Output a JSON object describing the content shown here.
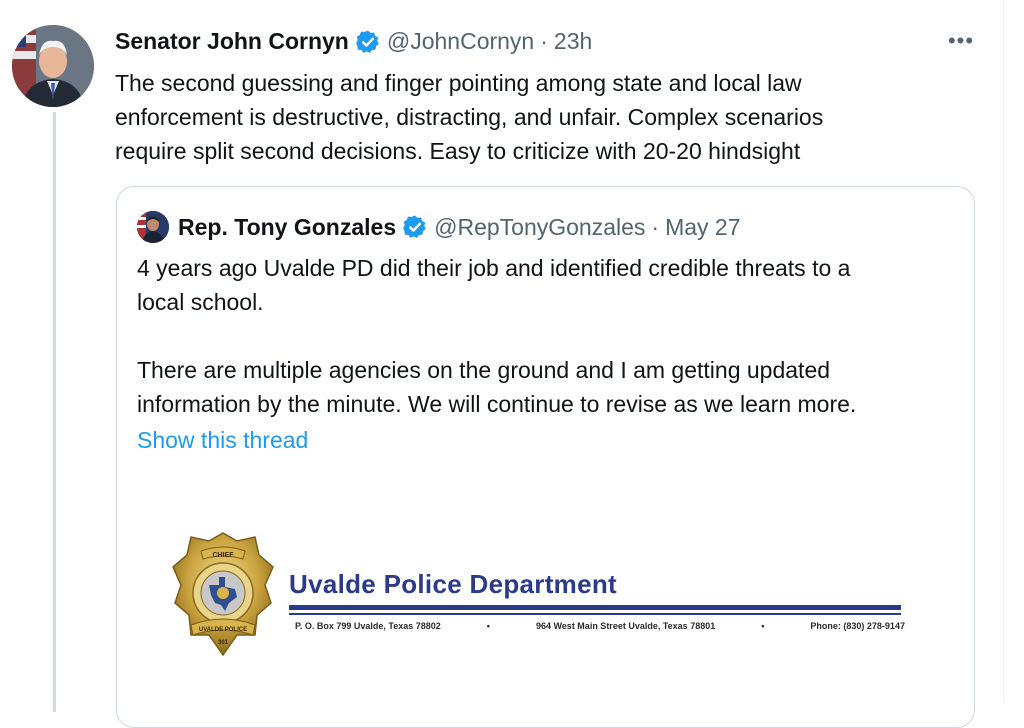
{
  "tweet": {
    "author_name": "Senator John Cornyn",
    "handle": "@JohnCornyn",
    "separator": "·",
    "time": "23h",
    "more_label": "•••",
    "text_lines": [
      "The second guessing and finger pointing among state and local law",
      "enforcement is destructive, distracting, and unfair.  Complex scenarios",
      "require split second decisions. Easy to criticize with 20-20 hindsight"
    ]
  },
  "quoted": {
    "author_name": "Rep. Tony Gonzales",
    "handle": "@RepTonyGonzales",
    "separator": "·",
    "time": "May 27",
    "paragraph1": [
      "4 years ago Uvalde PD did their job and identified credible threats to a",
      "local school."
    ],
    "paragraph2": [
      "There are multiple agencies on the ground and I am getting updated",
      "information by the minute. We will continue to revise as we learn more."
    ],
    "show_thread": "Show this thread",
    "image": {
      "badge_top": "CHIEF",
      "badge_bottom": "UVALDE POLICE",
      "badge_number": "301",
      "department": "Uvalde Police Department",
      "po_box": "P. O. Box 799 Uvalde, Texas 78802",
      "bullet1": "•",
      "street": "964 West Main Street Uvalde, Texas 78801",
      "bullet2": "•",
      "phone": "Phone: (830) 278-9147"
    }
  },
  "colors": {
    "link": "#1d9bf0",
    "verified": "#1d9bf0",
    "muted": "#536471",
    "letterhead_blue": "#2c3a8c"
  },
  "icons": {
    "verified": "verified-badge-icon",
    "more": "more-options-icon"
  }
}
